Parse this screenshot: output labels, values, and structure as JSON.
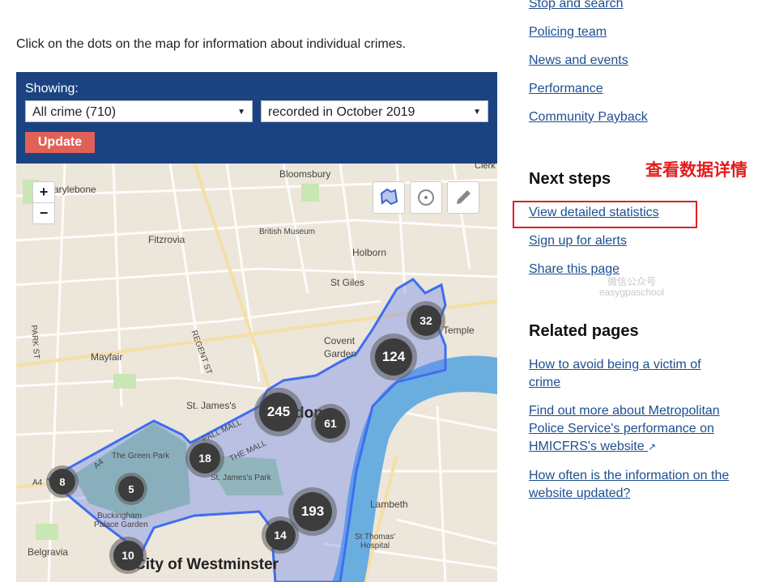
{
  "intro": "Click on the dots on the map for information about individual crimes.",
  "filter": {
    "showing_label": "Showing:",
    "crime_select": "All crime (710)",
    "month_select": "recorded in October 2019",
    "update_label": "Update"
  },
  "map": {
    "zoom_in": "+",
    "zoom_out": "−",
    "labels": {
      "marylebone": "Marylebone",
      "bloomsbury": "Bloomsbury",
      "fitzrovia": "Fitzrovia",
      "british_museum": "British Museum",
      "holborn": "Holborn",
      "st_giles": "St Giles",
      "covent_garden_1": "Covent",
      "covent_garden_2": "Garden",
      "temple": "Temple",
      "mayfair": "Mayfair",
      "regent_st": "REGENT ST",
      "park_st": "PARK ST",
      "st_james": "St. James's",
      "pall_mall": "PALL MALL",
      "the_mall": "THE MALL",
      "green_park": "The Green Park",
      "st_james_park": "St. James's Park",
      "buckingham_1": "Buckingham",
      "buckingham_2": "Palace Garden",
      "lambeth": "Lambeth",
      "st_thomas_1": "St Thomas'",
      "st_thomas_2": "Hospital",
      "belgravia": "Belgravia",
      "westminster": "City of Westminster",
      "london": "don",
      "a4": "A4",
      "a4b": "A4",
      "clerk": "Clerk"
    },
    "clusters": [
      {
        "count": "32"
      },
      {
        "count": "124"
      },
      {
        "count": "245"
      },
      {
        "count": "61"
      },
      {
        "count": "18"
      },
      {
        "count": "8"
      },
      {
        "count": "5"
      },
      {
        "count": "193"
      },
      {
        "count": "14"
      },
      {
        "count": "10"
      }
    ]
  },
  "sidebar": {
    "links_top": [
      "Stop and search",
      "Policing team",
      "News and events",
      "Performance",
      "Community Payback"
    ],
    "next_steps_title": "Next steps",
    "next_steps": [
      "View detailed statistics",
      "Sign up for alerts",
      "Share this page"
    ],
    "related_title": "Related pages",
    "related": [
      {
        "line1": "How to avoid being a victim of",
        "line2": "crime"
      },
      {
        "line1": "Find out more about Metropolitan",
        "line2": "Police Service's performance on",
        "line3": "HMICFRS's website"
      },
      {
        "line1": "How often is the information on the",
        "line2": "website updated?"
      }
    ]
  },
  "annotation": "查看数据详情",
  "watermark": {
    "line1": "微信公众号",
    "line2": "easygpaschool"
  },
  "colors": {
    "panel": "#1b4382",
    "update": "#e06256",
    "link": "#1d4f91",
    "annotation": "#e41c1c",
    "river": "#6aaee0",
    "area": "#3d6ef0"
  }
}
